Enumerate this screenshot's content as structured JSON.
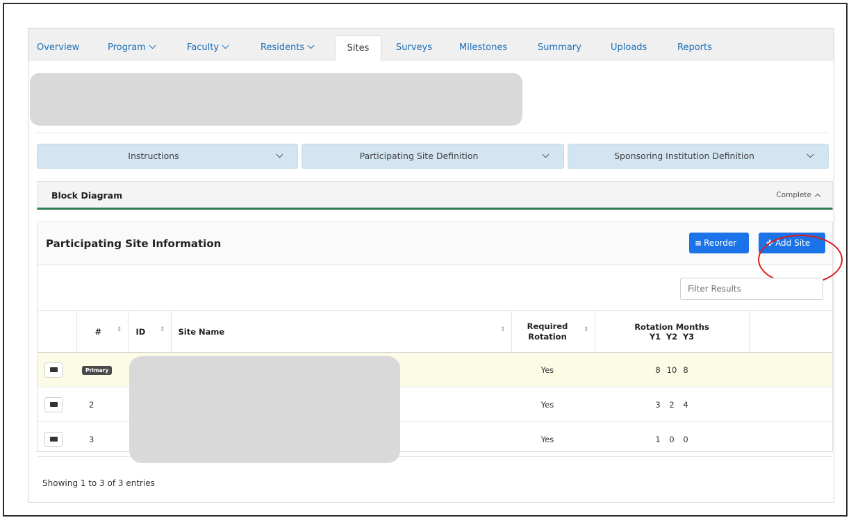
{
  "tabs": [
    {
      "label": "Overview",
      "dropdown": false
    },
    {
      "label": "Program",
      "dropdown": true
    },
    {
      "label": "Faculty",
      "dropdown": true
    },
    {
      "label": "Residents",
      "dropdown": true
    },
    {
      "label": "Sites",
      "dropdown": false,
      "active": true
    },
    {
      "label": "Surveys",
      "dropdown": false
    },
    {
      "label": "Milestones",
      "dropdown": false
    },
    {
      "label": "Summary",
      "dropdown": false
    },
    {
      "label": "Uploads",
      "dropdown": false
    },
    {
      "label": "Reports",
      "dropdown": false
    }
  ],
  "accordions": [
    {
      "label": "Instructions"
    },
    {
      "label": "Participating Site Definition"
    },
    {
      "label": "Sponsoring Institution Definition"
    }
  ],
  "block_diagram": {
    "title": "Block Diagram",
    "status": "Complete"
  },
  "card": {
    "title": "Participating Site Information",
    "reorder_label": "Reorder",
    "add_site_label": "Add Site",
    "filter_placeholder": "Filter Results"
  },
  "table": {
    "headers": {
      "num": "#",
      "id": "ID",
      "site_name": "Site Name",
      "required_rotation": "Required Rotation",
      "rotation_months": "Rotation Months",
      "years": [
        "Y1",
        "Y2",
        "Y3"
      ]
    },
    "rows": [
      {
        "num": "Primary",
        "is_primary": true,
        "required": "Yes",
        "months": [
          "8",
          "10",
          "8"
        ]
      },
      {
        "num": "2",
        "is_primary": false,
        "required": "Yes",
        "months": [
          "3",
          "2",
          "4"
        ]
      },
      {
        "num": "3",
        "is_primary": false,
        "required": "Yes",
        "months": [
          "1",
          "0",
          "0"
        ]
      }
    ]
  },
  "footer": {
    "entries_text": "Showing 1 to 3 of 3 entries"
  },
  "colors": {
    "accent": "#1a73e8",
    "tab_link": "#1d6fb8",
    "complete_bar": "#2e7d4f",
    "highlight_ring": "#e01b1b",
    "primary_row": "#fbfbe6"
  }
}
